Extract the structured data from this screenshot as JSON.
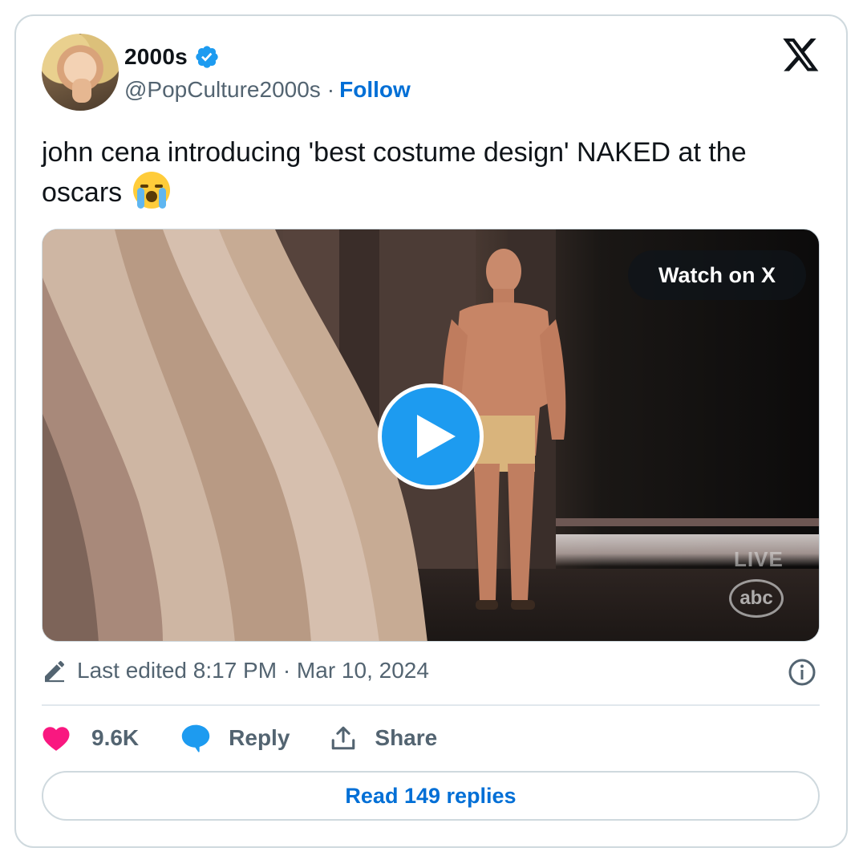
{
  "author": {
    "display_name": "2000s",
    "handle": "@PopCulture2000s",
    "separator": "·",
    "follow_label": "Follow",
    "verified_icon": "verified-badge-icon",
    "verified_color": "#1d9bf0"
  },
  "tweet": {
    "text": "john cena introducing 'best costume design' NAKED at the oscars",
    "emoji": "loudly-crying-face"
  },
  "video": {
    "watch_label": "Watch on X",
    "play_icon": "play-icon",
    "overlay_live": "LIVE",
    "overlay_network": "abc"
  },
  "meta": {
    "edited_text": "Last edited 8:17 PM · Mar 10, 2024",
    "edit_icon": "pencil-icon",
    "info_icon": "info-icon"
  },
  "actions": {
    "likes": "9.6K",
    "reply_label": "Reply",
    "share_label": "Share",
    "like_color": "#f91880",
    "reply_color": "#1d9bf0"
  },
  "read_replies_label": "Read 149 replies",
  "brand": {
    "logo": "x-logo-icon",
    "link_color": "#006fd6"
  }
}
